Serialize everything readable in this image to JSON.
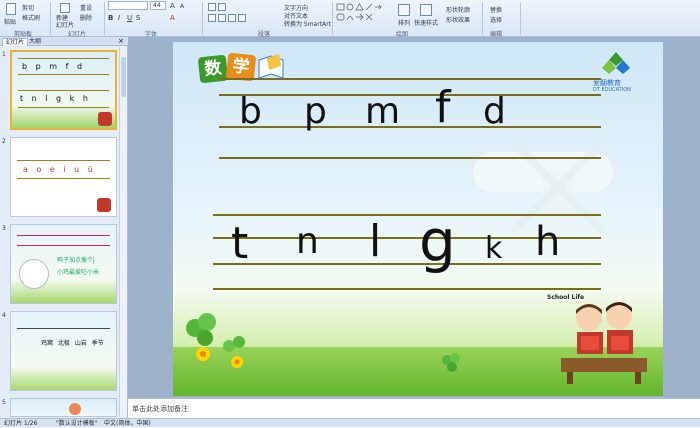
{
  "ribbon": {
    "font_size": "44",
    "clipboard_paste": "粘贴",
    "clipboard_cut": "剪切",
    "clipboard_format": "格式刷",
    "new_slide": "新建\n幻灯片",
    "reset": "重设",
    "delete": "删除",
    "text_direction": "文字方向",
    "align_text": "对齐文本",
    "convert_smartart": "转换为 SmartArt",
    "arrange": "排列",
    "quick_styles": "快速样式",
    "shape_fill": "形状轮廓",
    "shape_effect": "形状效果",
    "replace": "替换",
    "select": "选择",
    "groups": [
      "剪贴板",
      "幻灯片",
      "字体",
      "段落",
      "绘图",
      "编辑"
    ]
  },
  "sidebar": {
    "tabs": [
      "幻灯片",
      "大纲"
    ],
    "slides": [
      {
        "number": "1",
        "row1": "b p m f d",
        "row2": "t n l g k h"
      },
      {
        "number": "2",
        "row1": "a o e i u ü"
      },
      {
        "number": "3",
        "text1": "鸭子加点像个j",
        "text2": "小鸡最爱吃小米"
      },
      {
        "number": "4",
        "words": "鸡窝 北极 山岩 季节"
      },
      {
        "number": "5"
      }
    ]
  },
  "slide": {
    "title_chars": [
      "数",
      "学"
    ],
    "brand": "爱翻教育",
    "brand_en": "DT EDUCATION",
    "school_sign": "School Life",
    "row1": [
      "b",
      "p",
      "m",
      "f",
      "d"
    ],
    "row2": [
      "t",
      "n",
      "l",
      "g",
      "k",
      "h"
    ]
  },
  "notes": {
    "placeholder": "单击此处添加备注"
  },
  "status": {
    "slide_count": "幻灯片 1/26",
    "theme": "\"数认设计模板\"",
    "language": "中文(简体，中国)"
  },
  "colors": {
    "accent": "#f0b030",
    "line": "#7a6e1a",
    "title_green": "#3b9a2b",
    "title_orange": "#e88c1a"
  }
}
